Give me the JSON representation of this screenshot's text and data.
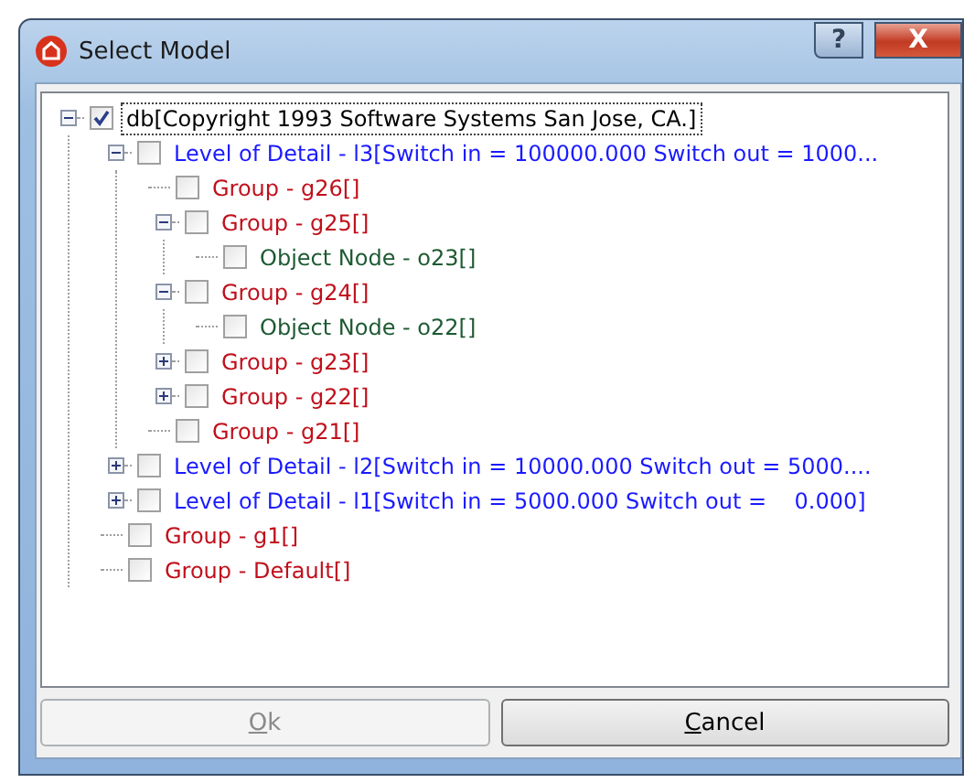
{
  "window": {
    "title": "Select Model",
    "help_button": "?",
    "close_button": "X"
  },
  "tree": [
    {
      "label": "db[Copyright 1993 Software Systems San Jose, CA.]",
      "kind": "db",
      "checked": true,
      "selected": true,
      "expanded": true,
      "children": [
        {
          "label": "Level of Detail - l3[Switch in = 100000.000 Switch out = 1000...",
          "kind": "lod",
          "checked": false,
          "selected": false,
          "expanded": true,
          "children": [
            {
              "label": "Group - g26[]",
              "kind": "group",
              "checked": false,
              "selected": false
            },
            {
              "label": "Group - g25[]",
              "kind": "group",
              "checked": false,
              "selected": false,
              "expanded": true,
              "children": [
                {
                  "label": "Object Node - o23[]",
                  "kind": "object",
                  "checked": false,
                  "selected": false
                }
              ]
            },
            {
              "label": "Group - g24[]",
              "kind": "group",
              "checked": false,
              "selected": false,
              "expanded": true,
              "children": [
                {
                  "label": "Object Node - o22[]",
                  "kind": "object",
                  "checked": false,
                  "selected": false
                }
              ]
            },
            {
              "label": "Group - g23[]",
              "kind": "group",
              "checked": false,
              "selected": false,
              "expanded": false
            },
            {
              "label": "Group - g22[]",
              "kind": "group",
              "checked": false,
              "selected": false,
              "expanded": false
            },
            {
              "label": "Group - g21[]",
              "kind": "group",
              "checked": false,
              "selected": false
            }
          ]
        },
        {
          "label": "Level of Detail - l2[Switch in = 10000.000 Switch out = 5000....",
          "kind": "lod",
          "checked": false,
          "selected": false,
          "expanded": false
        },
        {
          "label": "Level of Detail - l1[Switch in = 5000.000 Switch out =    0.000]",
          "kind": "lod",
          "checked": false,
          "selected": false,
          "expanded": false
        },
        {
          "label": "Group - g1[]",
          "kind": "group",
          "checked": false,
          "selected": false
        },
        {
          "label": "Group - Default[]",
          "kind": "group",
          "checked": false,
          "selected": false
        }
      ]
    }
  ],
  "buttons": [
    {
      "label": "Ok",
      "disabled": true
    },
    {
      "label": "Cancel",
      "disabled": false
    }
  ]
}
